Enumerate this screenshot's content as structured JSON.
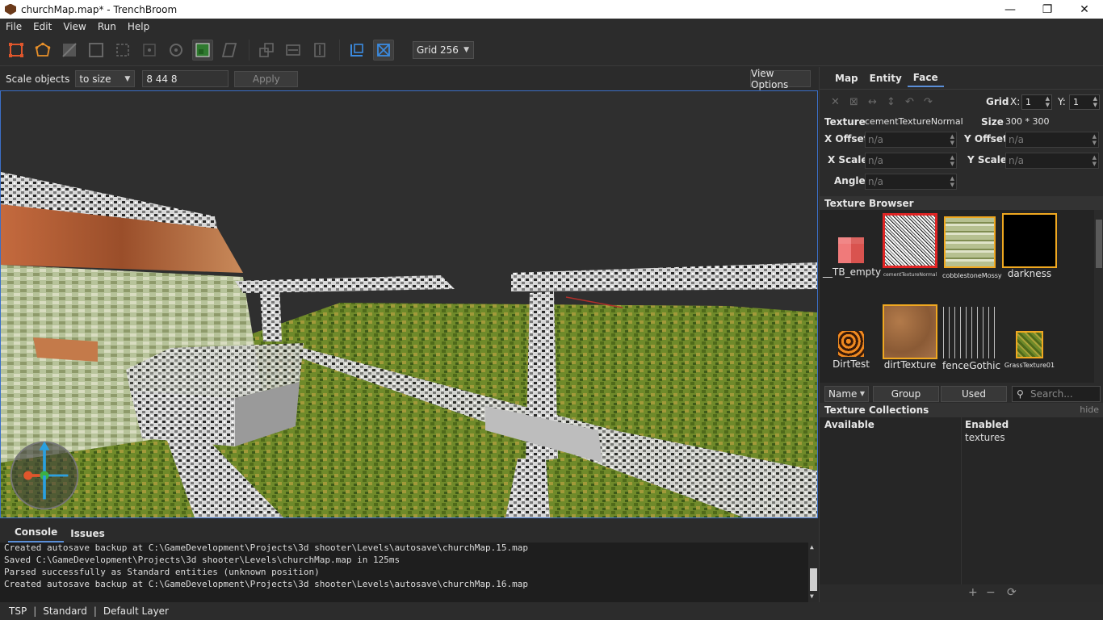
{
  "window": {
    "title": "churchMap.map* - TrenchBroom",
    "min_icon": "minimize-icon",
    "max_icon": "maximize-icon",
    "close_icon": "close-icon"
  },
  "menu": [
    "File",
    "Edit",
    "View",
    "Run",
    "Help"
  ],
  "toolbar": {
    "grid_label": "Grid 256",
    "tools": [
      {
        "name": "clip-tool-icon",
        "active": false
      },
      {
        "name": "vertex-tool-icon",
        "active": false
      },
      {
        "name": "edge-tool-icon",
        "active": false
      },
      {
        "name": "face-tool-icon",
        "active": false
      },
      {
        "name": "rotate-tool-icon",
        "active": false
      },
      {
        "name": "scale-tool-icon",
        "active": false
      },
      {
        "name": "shear-tool-icon",
        "active": false
      },
      {
        "name": "texture-lock-icon",
        "active": true
      },
      {
        "name": "uv-lock-icon",
        "active": false
      }
    ]
  },
  "scalebar": {
    "label": "Scale objects",
    "mode": "to size",
    "value": "8 44 8",
    "apply": "Apply",
    "view_options": "View Options"
  },
  "right": {
    "tabs": [
      "Map",
      "Entity",
      "Face"
    ],
    "active_tab": "Face",
    "grid": {
      "label": "Grid",
      "x_label": "X:",
      "x": "1",
      "y_label": "Y:",
      "y": "1"
    },
    "face": {
      "texture_label": "Texture",
      "texture": "cementTextureNormal",
      "size_label": "Size",
      "size": "300 * 300",
      "x_offset_label": "X Offset",
      "y_offset_label": "Y Offset",
      "x_scale_label": "X Scale",
      "y_scale_label": "Y Scale",
      "angle_label": "Angle",
      "na": "n/a"
    },
    "texture_browser": {
      "title": "Texture Browser",
      "textures": [
        {
          "name": "__TB_empty",
          "selected": false
        },
        {
          "name": "cementTextureNormal",
          "selected": true
        },
        {
          "name": "cobblestoneMossy",
          "selected": false
        },
        {
          "name": "darkness",
          "selected": false
        },
        {
          "name": "DirtTest",
          "selected": false
        },
        {
          "name": "dirtTexture",
          "selected": false
        },
        {
          "name": "fenceGothic",
          "selected": false
        },
        {
          "name": "GrassTexture01",
          "selected": false
        }
      ],
      "sort": "Name",
      "group": "Group",
      "used": "Used",
      "search_placeholder": "Search..."
    },
    "collections": {
      "title": "Texture Collections",
      "hide": "hide",
      "available": "Available",
      "enabled": "Enabled",
      "enabled_items": [
        "textures"
      ]
    }
  },
  "console": {
    "tabs": [
      "Console",
      "Issues"
    ],
    "lines": [
      "Created autosave backup at C:\\GameDevelopment\\Projects\\3d shooter\\Levels\\autosave\\churchMap.15.map",
      "Saved C:\\GameDevelopment\\Projects\\3d shooter\\Levels\\churchMap.map in 125ms",
      "Parsed successfully as Standard entities (unknown position)",
      "Created autosave backup at C:\\GameDevelopment\\Projects\\3d shooter\\Levels\\autosave\\churchMap.16.map"
    ]
  },
  "status": {
    "game": "TSP",
    "mode": "Standard",
    "layer": "Default Layer"
  },
  "colors": {
    "accent": "#3b6fc7",
    "selected_border": "#e02424",
    "highlight_border": "#f0a820",
    "background": "#2b2b2b"
  }
}
